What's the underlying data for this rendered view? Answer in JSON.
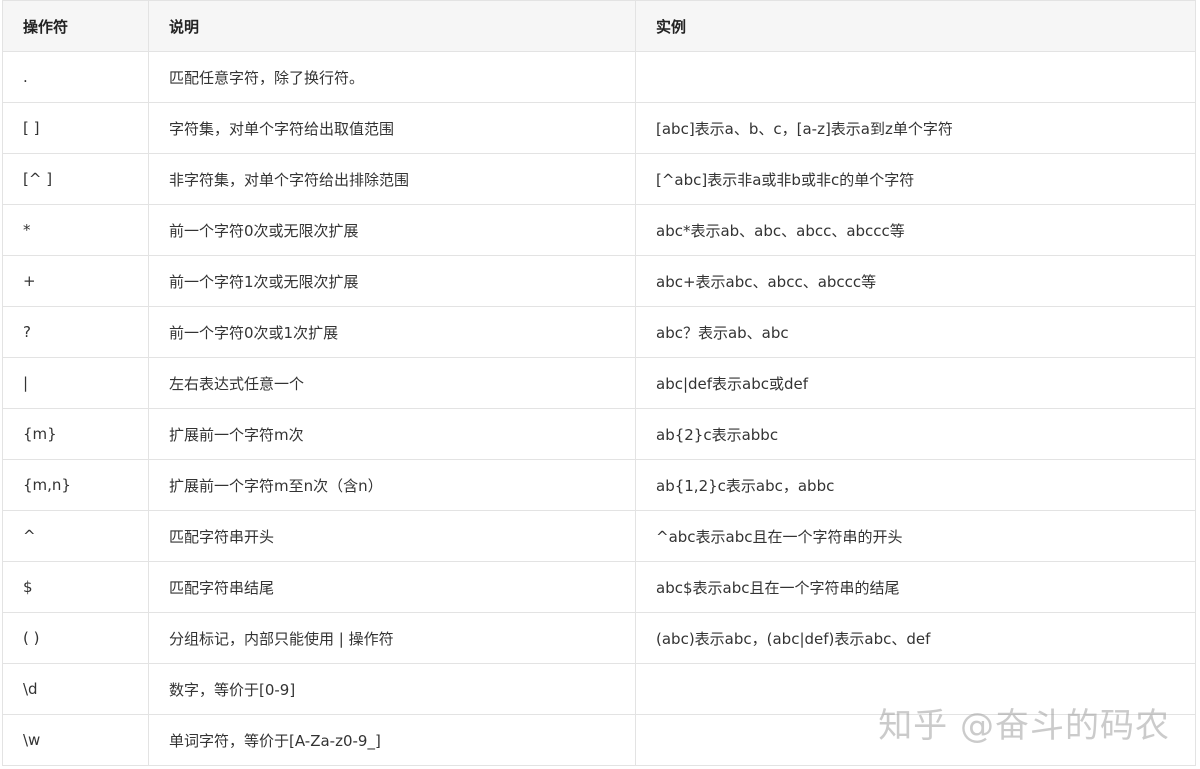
{
  "table": {
    "headers": [
      "操作符",
      "说明",
      "实例"
    ],
    "rows": [
      {
        "op": ".",
        "desc": "匹配任意字符，除了换行符。",
        "example": ""
      },
      {
        "op": "[ ]",
        "desc": "字符集，对单个字符给出取值范围",
        "example": "[abc]表示a、b、c，[a-z]表示a到z单个字符"
      },
      {
        "op": "[^ ]",
        "desc": "非字符集，对单个字符给出排除范围",
        "example": "[^abc]表示非a或非b或非c的单个字符"
      },
      {
        "op": "*",
        "desc": "前一个字符0次或无限次扩展",
        "example": "abc*表示ab、abc、abcc、abccc等"
      },
      {
        "op": "+",
        "desc": "前一个字符1次或无限次扩展",
        "example": "abc+表示abc、abcc、abccc等"
      },
      {
        "op": "?",
        "desc": "前一个字符0次或1次扩展",
        "example": "abc？表示ab、abc"
      },
      {
        "op": "|",
        "desc": "左右表达式任意一个",
        "example": "abc|def表示abc或def"
      },
      {
        "op": "{m}",
        "desc": "扩展前一个字符m次",
        "example": "ab{2}c表示abbc"
      },
      {
        "op": "{m,n}",
        "desc": "扩展前一个字符m至n次（含n）",
        "example": "ab{1,2}c表示abc，abbc"
      },
      {
        "op": "^",
        "desc": "匹配字符串开头",
        "example": "^abc表示abc且在一个字符串的开头"
      },
      {
        "op": "$",
        "desc": "匹配字符串结尾",
        "example": "abc$表示abc且在一个字符串的结尾"
      },
      {
        "op": "( )",
        "desc": "分组标记，内部只能使用 | 操作符",
        "example": "(abc)表示abc，(abc|def)表示abc、def"
      },
      {
        "op": "\\d",
        "desc": "数字，等价于[0-9]",
        "example": ""
      },
      {
        "op": "\\w",
        "desc": "单词字符，等价于[A-Za-z0-9_]",
        "example": ""
      }
    ]
  },
  "watermark": "知乎 @奋斗的码农"
}
